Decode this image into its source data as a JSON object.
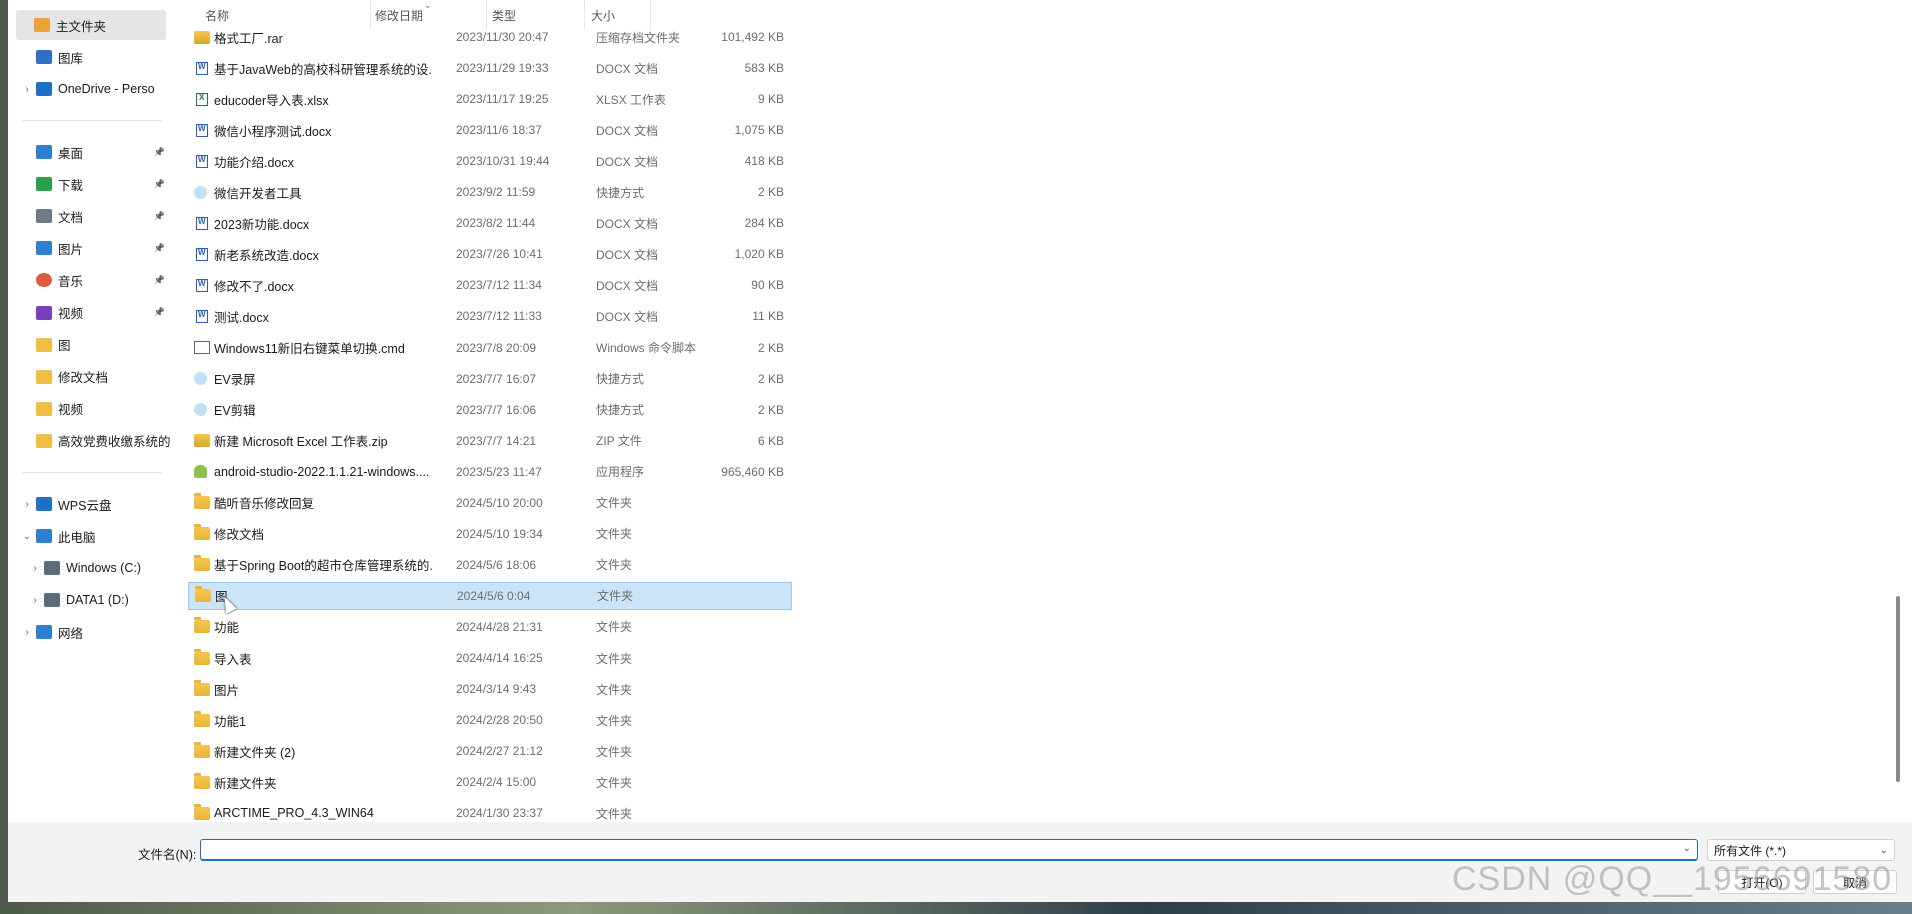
{
  "sidebar": {
    "quick": [
      {
        "label": "主文件夹",
        "icon": "home-icon",
        "selected": true
      },
      {
        "label": "图库",
        "icon": "gallery-icon"
      },
      {
        "label": "OneDrive - Perso",
        "icon": "cloud-icon",
        "expandable": true
      }
    ],
    "pinned": [
      {
        "label": "桌面",
        "icon": "desktop-icon",
        "pinned": true
      },
      {
        "label": "下载",
        "icon": "download-icon",
        "pinned": true
      },
      {
        "label": "文档",
        "icon": "documents-icon",
        "pinned": true
      },
      {
        "label": "图片",
        "icon": "pictures-icon",
        "pinned": true
      },
      {
        "label": "音乐",
        "icon": "music-icon",
        "pinned": true
      },
      {
        "label": "视频",
        "icon": "videos-icon",
        "pinned": true
      },
      {
        "label": "图",
        "icon": "folder-icon"
      },
      {
        "label": "修改文档",
        "icon": "folder-icon"
      },
      {
        "label": "视频",
        "icon": "folder-icon"
      },
      {
        "label": "高效党费收缴系统的",
        "icon": "folder-icon"
      }
    ],
    "devices": [
      {
        "label": "WPS云盘",
        "icon": "cloud-icon",
        "chev": "›"
      },
      {
        "label": "此电脑",
        "icon": "computer-icon",
        "chev": "⌄"
      },
      {
        "label": "Windows (C:)",
        "icon": "drive-icon",
        "chev": "›",
        "indent": true
      },
      {
        "label": "DATA1 (D:)",
        "icon": "drive-icon",
        "chev": "›",
        "indent": true
      },
      {
        "label": "网络",
        "icon": "network-icon",
        "chev": "›"
      }
    ]
  },
  "columns": {
    "name": "名称",
    "date": "修改日期",
    "type": "类型",
    "size": "大小"
  },
  "files": [
    {
      "name": "格式工厂.rar",
      "date": "2023/11/30 20:47",
      "type": "压缩存档文件夹",
      "size": "101,492 KB",
      "kind": "zip"
    },
    {
      "name": "基于JavaWeb的高校科研管理系统的设...",
      "date": "2023/11/29 19:33",
      "type": "DOCX 文档",
      "size": "583 KB",
      "kind": "docx"
    },
    {
      "name": "educoder导入表.xlsx",
      "date": "2023/11/17 19:25",
      "type": "XLSX 工作表",
      "size": "9 KB",
      "kind": "xlsx"
    },
    {
      "name": "微信小程序测试.docx",
      "date": "2023/11/6 18:37",
      "type": "DOCX 文档",
      "size": "1,075 KB",
      "kind": "docx"
    },
    {
      "name": "功能介绍.docx",
      "date": "2023/10/31 19:44",
      "type": "DOCX 文档",
      "size": "418 KB",
      "kind": "docx"
    },
    {
      "name": "微信开发者工具",
      "date": "2023/9/2 11:59",
      "type": "快捷方式",
      "size": "2 KB",
      "kind": "lnk"
    },
    {
      "name": "2023新功能.docx",
      "date": "2023/8/2 11:44",
      "type": "DOCX 文档",
      "size": "284 KB",
      "kind": "docx"
    },
    {
      "name": "新老系统改造.docx",
      "date": "2023/7/26 10:41",
      "type": "DOCX 文档",
      "size": "1,020 KB",
      "kind": "docx"
    },
    {
      "name": "修改不了.docx",
      "date": "2023/7/12 11:34",
      "type": "DOCX 文档",
      "size": "90 KB",
      "kind": "docx"
    },
    {
      "name": "测试.docx",
      "date": "2023/7/12 11:33",
      "type": "DOCX 文档",
      "size": "11 KB",
      "kind": "docx"
    },
    {
      "name": "Windows11新旧右键菜单切换.cmd",
      "date": "2023/7/8 20:09",
      "type": "Windows 命令脚本",
      "size": "2 KB",
      "kind": "cmd"
    },
    {
      "name": "EV录屏",
      "date": "2023/7/7 16:07",
      "type": "快捷方式",
      "size": "2 KB",
      "kind": "lnk"
    },
    {
      "name": "EV剪辑",
      "date": "2023/7/7 16:06",
      "type": "快捷方式",
      "size": "2 KB",
      "kind": "lnk"
    },
    {
      "name": "新建 Microsoft Excel 工作表.zip",
      "date": "2023/7/7 14:21",
      "type": "ZIP 文件",
      "size": "6 KB",
      "kind": "zip"
    },
    {
      "name": "android-studio-2022.1.1.21-windows....",
      "date": "2023/5/23 11:47",
      "type": "应用程序",
      "size": "965,460 KB",
      "kind": "apk"
    },
    {
      "name": "酷听音乐修改回复",
      "date": "2024/5/10 20:00",
      "type": "文件夹",
      "size": "",
      "kind": "folder"
    },
    {
      "name": "修改文档",
      "date": "2024/5/10 19:34",
      "type": "文件夹",
      "size": "",
      "kind": "folder"
    },
    {
      "name": "基于Spring Boot的超市仓库管理系统的...",
      "date": "2024/5/6 18:06",
      "type": "文件夹",
      "size": "",
      "kind": "folder"
    },
    {
      "name": "图",
      "date": "2024/5/6 0:04",
      "type": "文件夹",
      "size": "",
      "kind": "folder",
      "selected": true
    },
    {
      "name": "功能",
      "date": "2024/4/28 21:31",
      "type": "文件夹",
      "size": "",
      "kind": "folder"
    },
    {
      "name": "导入表",
      "date": "2024/4/14 16:25",
      "type": "文件夹",
      "size": "",
      "kind": "folder"
    },
    {
      "name": "图片",
      "date": "2024/3/14 9:43",
      "type": "文件夹",
      "size": "",
      "kind": "folder"
    },
    {
      "name": "功能1",
      "date": "2024/2/28 20:50",
      "type": "文件夹",
      "size": "",
      "kind": "folder"
    },
    {
      "name": "新建文件夹 (2)",
      "date": "2024/2/27 21:12",
      "type": "文件夹",
      "size": "",
      "kind": "folder"
    },
    {
      "name": "新建文件夹",
      "date": "2024/2/4 15:00",
      "type": "文件夹",
      "size": "",
      "kind": "folder"
    },
    {
      "name": "ARCTIME_PRO_4.3_WIN64",
      "date": "2024/1/30 23:37",
      "type": "文件夹",
      "size": "",
      "kind": "folder"
    }
  ],
  "bottom": {
    "filename_label": "文件名(N):",
    "filename_value": "",
    "filetype": "所有文件 (*.*)",
    "open_label": "打开(O)",
    "cancel_label": "取消"
  },
  "watermark": "CSDN @QQ__1956691580"
}
